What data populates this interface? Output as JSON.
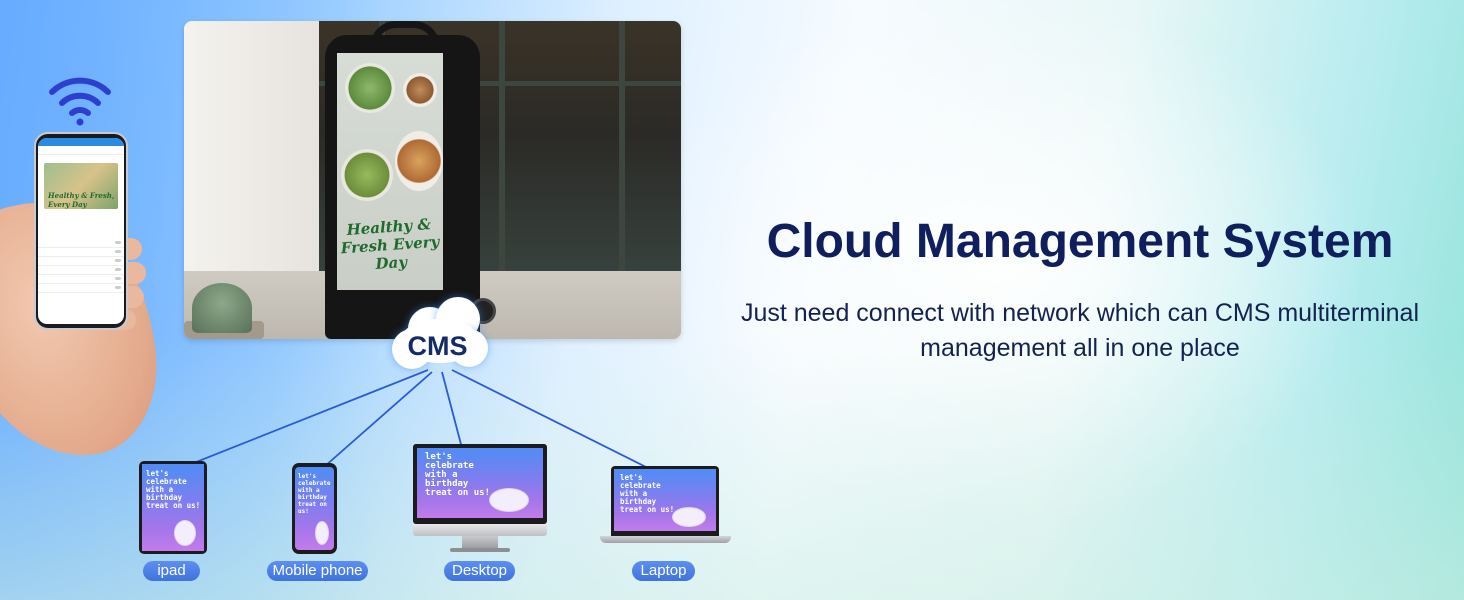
{
  "headline": "Cloud Management System",
  "subtext": "Just need connect with network which can CMS multiterminal management all in one place",
  "cloud": {
    "label": "CMS"
  },
  "sign": {
    "screen_text": "Healthy & Fresh Every Day"
  },
  "phone_app": {
    "image_text": "Healthy & Fresh, Every Day"
  },
  "device_screen_text": "let's\ncelebrate\nwith a\nbirthday\ntreat on us!",
  "devices": [
    {
      "label": "ipad"
    },
    {
      "label": "Mobile phone"
    },
    {
      "label": "Desktop"
    },
    {
      "label": "Laptop"
    }
  ],
  "colors": {
    "headline": "#0f1e5c",
    "link_lines": "#2a5bd7",
    "label_pill": "#4a7fe6"
  },
  "icons": [
    "wifi-icon",
    "cloud-icon"
  ]
}
